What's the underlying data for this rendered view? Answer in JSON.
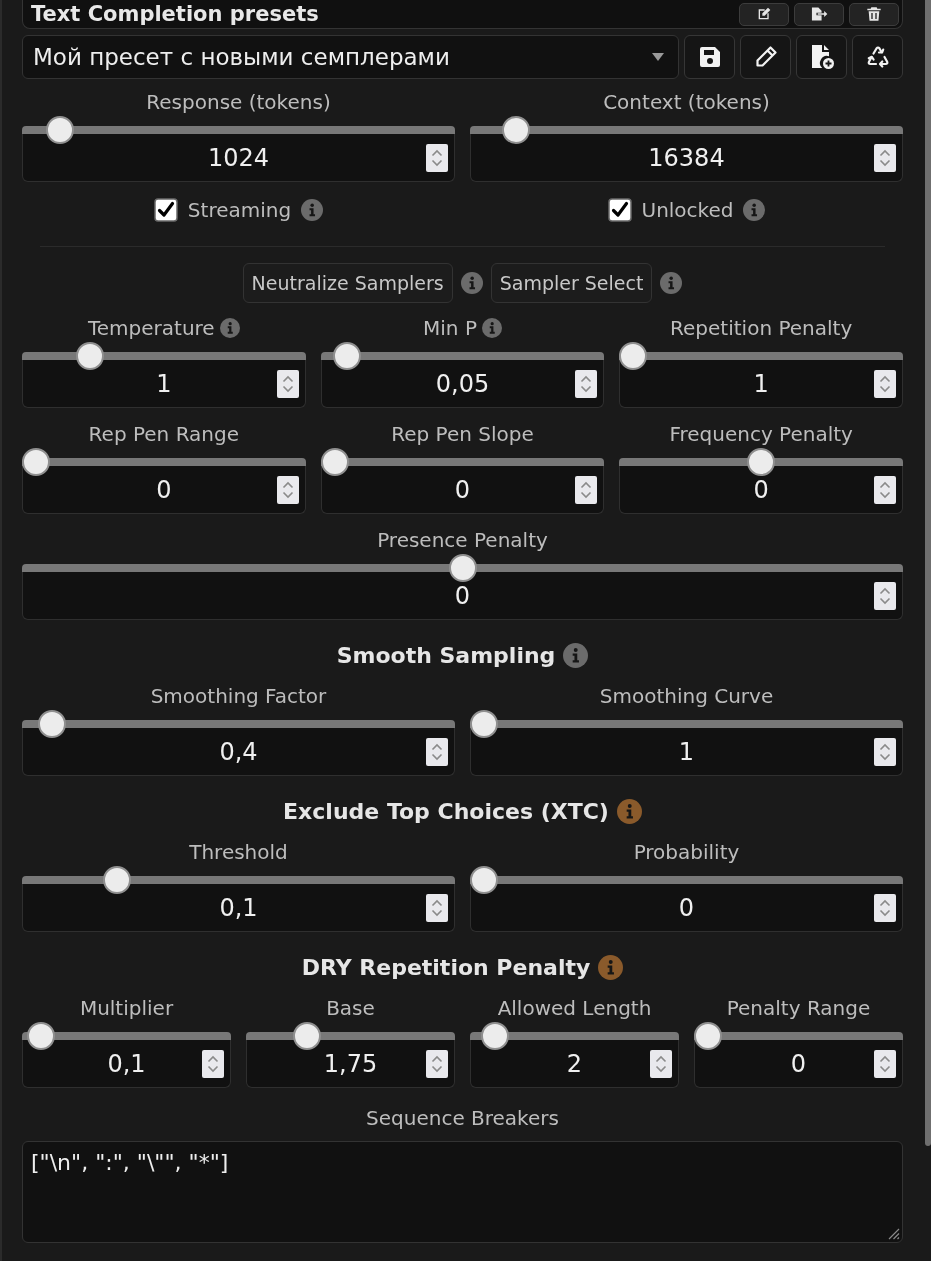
{
  "header": {
    "title": "Text Completion presets"
  },
  "preset": {
    "value": "Мой пресет с новыми семплерами"
  },
  "main_sliders": [
    {
      "label": "Response (tokens)",
      "info": false,
      "value": "1024",
      "level": 0.06
    },
    {
      "label": "Context (tokens)",
      "info": false,
      "value": "16384",
      "level": 0.08
    }
  ],
  "toggles": [
    {
      "label": "Streaming",
      "checked": true,
      "info": true
    },
    {
      "label": "Unlocked",
      "checked": true,
      "info": true
    }
  ],
  "sampler_buttons": [
    {
      "label": "Neutralize Samplers",
      "info": true
    },
    {
      "label": "Sampler Select",
      "info": true
    }
  ],
  "sampler_rows": [
    [
      {
        "label": "Temperature",
        "info": true,
        "value": "1",
        "level": 0.21
      },
      {
        "label": "Min P",
        "info": true,
        "value": "0,05",
        "level": 0.05
      },
      {
        "label": "Repetition Penalty",
        "info": false,
        "value": "1",
        "level": 0
      }
    ],
    [
      {
        "label": "Rep Pen Range",
        "info": false,
        "value": "0",
        "level": 0
      },
      {
        "label": "Rep Pen Slope",
        "info": false,
        "value": "0",
        "level": 0
      },
      {
        "label": "Frequency Penalty",
        "info": false,
        "value": "0",
        "level": 0.5
      }
    ],
    [
      {
        "label": "Presence Penalty",
        "info": false,
        "value": "0",
        "level": 0.5
      }
    ]
  ],
  "sections": [
    {
      "title": "Smooth Sampling",
      "info": {
        "color": "#6b6b6b"
      },
      "rows": [
        [
          {
            "label": "Smoothing Factor",
            "info": false,
            "value": "0,4",
            "level": 0.04
          },
          {
            "label": "Smoothing Curve",
            "info": false,
            "value": "1",
            "level": 0
          }
        ]
      ]
    },
    {
      "title": "Exclude Top Choices (XTC)",
      "info": {
        "color": "#8a5a2b"
      },
      "rows": [
        [
          {
            "label": "Threshold",
            "info": false,
            "value": "0,1",
            "level": 0.2
          },
          {
            "label": "Probability",
            "info": false,
            "value": "0",
            "level": 0
          }
        ]
      ]
    },
    {
      "title": "DRY Repetition Penalty",
      "info": {
        "color": "#8a5a2b"
      },
      "rows": [
        [
          {
            "label": "Multiplier",
            "info": false,
            "value": "0,1",
            "level": 0.03
          },
          {
            "label": "Base",
            "info": false,
            "value": "1,75",
            "level": 0.26
          },
          {
            "label": "Allowed Length",
            "info": false,
            "value": "2",
            "level": 0.06
          },
          {
            "label": "Penalty Range",
            "info": false,
            "value": "0",
            "level": 0
          }
        ]
      ],
      "text_field": {
        "label": "Sequence Breakers",
        "value": "[\"\\n\", \":\", \"\\\"\", \"*\"]"
      }
    }
  ]
}
